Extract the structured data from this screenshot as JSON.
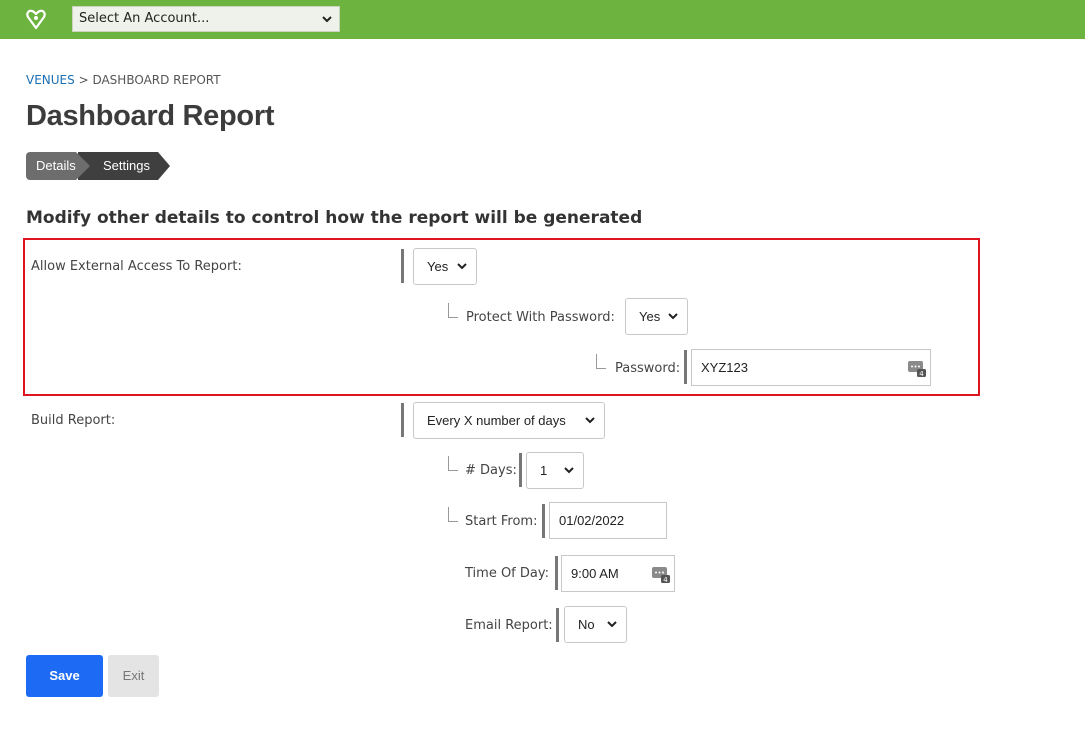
{
  "topbar": {
    "account_select": {
      "value": "Select An Account..."
    }
  },
  "breadcrumb": {
    "link": "VENUES",
    "separator": " > ",
    "current": "DASHBOARD REPORT"
  },
  "page": {
    "title": "Dashboard Report"
  },
  "steps": [
    {
      "label": "Details"
    },
    {
      "label": "Settings"
    }
  ],
  "section": {
    "heading": "Modify other details to control how the report will be generated"
  },
  "form": {
    "external_access": {
      "label": "Allow External Access To Report:",
      "value": "Yes"
    },
    "protect_password": {
      "label": "Protect With Password:",
      "value": "Yes"
    },
    "password": {
      "label": "Password:",
      "value": "XYZ123"
    },
    "build_report": {
      "label": "Build Report:",
      "value": "Every X number of days"
    },
    "days": {
      "label": "# Days:",
      "value": "1"
    },
    "start_from": {
      "label": "Start From:",
      "value": "01/02/2022"
    },
    "time_of_day": {
      "label": "Time Of Day:",
      "value": "9:00 AM"
    },
    "email_report": {
      "label": "Email Report:",
      "value": "No"
    }
  },
  "buttons": {
    "save": "Save",
    "exit": "Exit"
  },
  "colors": {
    "topbar": "#6db33f",
    "highlight": "#e0141e",
    "save_button": "#1d6bf5"
  },
  "icons": {
    "logo": "brand-heart-logo",
    "keyboard": "keyboard-icon",
    "chevron": "chevron-down-icon"
  }
}
